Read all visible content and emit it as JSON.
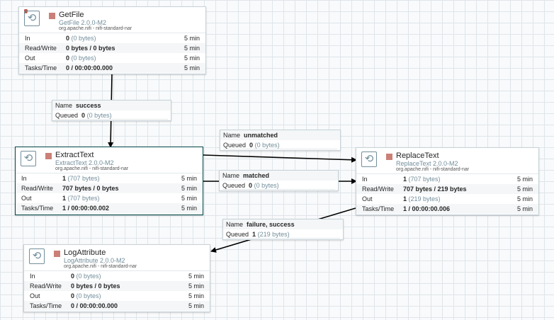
{
  "processors": {
    "getfile": {
      "name": "GetFile",
      "type": "GetFile 2.0.0-M2",
      "bundle": "org.apache.nifi - nifi-standard-nar",
      "in_label": "In",
      "in_value": "0",
      "in_bytes": "(0 bytes)",
      "in_window": "5 min",
      "rw_label": "Read/Write",
      "rw_value": "0 bytes / 0 bytes",
      "rw_window": "5 min",
      "out_label": "Out",
      "out_value": "0",
      "out_bytes": "(0 bytes)",
      "out_window": "5 min",
      "tasks_label": "Tasks/Time",
      "tasks_value": "0 / 00:00:00.000",
      "tasks_window": "5 min"
    },
    "extracttext": {
      "name": "ExtractText",
      "type": "ExtractText 2.0.0-M2",
      "bundle": "org.apache.nifi - nifi-standard-nar",
      "in_label": "In",
      "in_value": "1",
      "in_bytes": "(707 bytes)",
      "in_window": "5 min",
      "rw_label": "Read/Write",
      "rw_value": "707 bytes / 0 bytes",
      "rw_window": "5 min",
      "out_label": "Out",
      "out_value": "1",
      "out_bytes": "(707 bytes)",
      "out_window": "5 min",
      "tasks_label": "Tasks/Time",
      "tasks_value": "1 / 00:00:00.002",
      "tasks_window": "5 min"
    },
    "replacetext": {
      "name": "ReplaceText",
      "type": "ReplaceText 2.0.0-M2",
      "bundle": "org.apache.nifi - nifi-standard-nar",
      "in_label": "In",
      "in_value": "1",
      "in_bytes": "(707 bytes)",
      "in_window": "5 min",
      "rw_label": "Read/Write",
      "rw_value": "707 bytes / 219 bytes",
      "rw_window": "5 min",
      "out_label": "Out",
      "out_value": "1",
      "out_bytes": "(219 bytes)",
      "out_window": "5 min",
      "tasks_label": "Tasks/Time",
      "tasks_value": "1 / 00:00:00.006",
      "tasks_window": "5 min"
    },
    "logattribute": {
      "name": "LogAttribute",
      "type": "LogAttribute 2.0.0-M2",
      "bundle": "org.apache.nifi - nifi-standard-nar",
      "in_label": "In",
      "in_value": "0",
      "in_bytes": "(0 bytes)",
      "in_window": "5 min",
      "rw_label": "Read/Write",
      "rw_value": "0 bytes / 0 bytes",
      "rw_window": "5 min",
      "out_label": "Out",
      "out_value": "0",
      "out_bytes": "(0 bytes)",
      "out_window": "5 min",
      "tasks_label": "Tasks/Time",
      "tasks_value": "0 / 00:00:00.000",
      "tasks_window": "5 min"
    }
  },
  "connections": {
    "success": {
      "name_label": "Name",
      "name": "success",
      "queued_label": "Queued",
      "count": "0",
      "bytes": "(0 bytes)"
    },
    "unmatched": {
      "name_label": "Name",
      "name": "unmatched",
      "queued_label": "Queued",
      "count": "0",
      "bytes": "(0 bytes)"
    },
    "matched": {
      "name_label": "Name",
      "name": "matched",
      "queued_label": "Queued",
      "count": "0",
      "bytes": "(0 bytes)"
    },
    "failure_success": {
      "name_label": "Name",
      "name": "failure, success",
      "queued_label": "Queued",
      "count": "1",
      "bytes": "(219 bytes)"
    }
  },
  "icons": {
    "processor": "processor-icon",
    "stopped": "stopped-state-icon",
    "restricted": "restricted-icon"
  },
  "colors": {
    "stopped": "#ba554a",
    "selected_border": "#004849",
    "connection_line": "#000000",
    "canvas_grid": "#dfe5ea"
  }
}
